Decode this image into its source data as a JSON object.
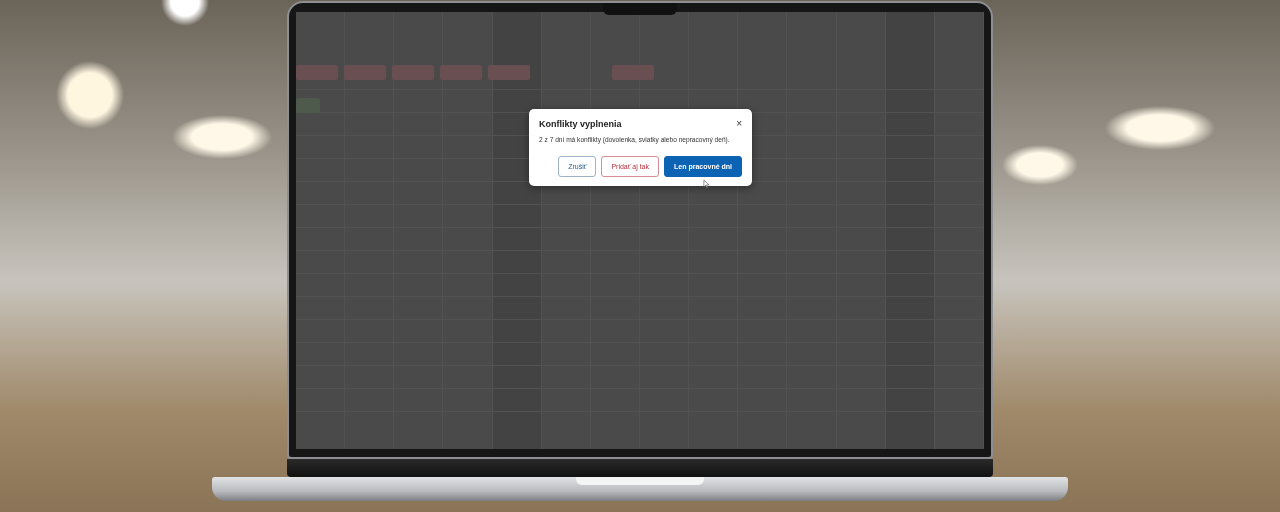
{
  "dialog": {
    "title": "Konflikty vyplnenia",
    "close": "×",
    "message": "2 z 7 dní má konflikty (dovolenka, sviatky alebo nepracovný deň).",
    "buttons": [
      {
        "label": "Zrušiť",
        "kind": "secondary"
      },
      {
        "label": "Pridať aj tak",
        "kind": "danger"
      },
      {
        "label": "Len pracovné dni",
        "kind": "primary"
      }
    ]
  }
}
